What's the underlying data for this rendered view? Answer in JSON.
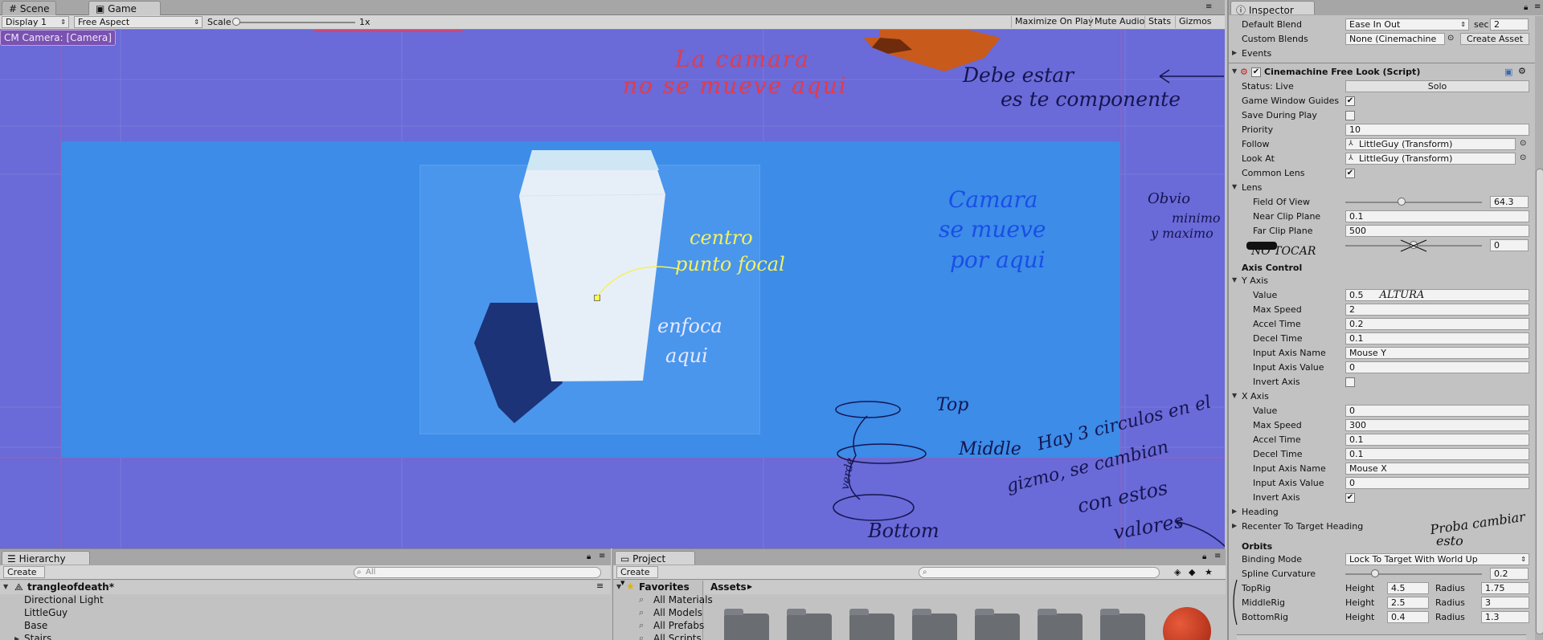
{
  "tabs": {
    "scene": "Scene",
    "game": "Game"
  },
  "game_toolbar": {
    "display": "Display 1",
    "aspect": "Free Aspect",
    "scale_label": "Scale",
    "scale_value": "1x",
    "maximize": "Maximize On Play",
    "mute": "Mute Audio",
    "stats": "Stats",
    "gizmos": "Gizmos"
  },
  "cm_camera_label": "CM Camera: [Camera]",
  "annotations": {
    "no_move_1": "La camara",
    "no_move_2": "no se mueve aqui",
    "must_be_1": "Debe estar",
    "must_be_2": "es te componente",
    "moves_1": "Camara",
    "moves_2": "se mueve",
    "moves_3": "por aqui",
    "center_1": "centro",
    "center_2": "punto focal",
    "focus_1": "enfoca",
    "focus_2": "aqui",
    "top": "Top",
    "middle": "Middle",
    "bottom": "Bottom",
    "side": "verde",
    "circles_1": "Hay 3 circulos en el",
    "circles_2": "gizmo, se cambian",
    "circles_3": "con estos",
    "circles_4": "valores",
    "obvio_1": "Obvio",
    "obvio_2": "minimo",
    "obvio_3": "y maximo",
    "no_tocar": "NO TOCAR",
    "altura": "ALTURA",
    "proba_1": "Proba cambiar",
    "proba_2": "esto"
  },
  "hierarchy": {
    "tab": "Hierarchy",
    "create": "Create",
    "search_placeholder": "All",
    "scene_name": "trangleofdeath*",
    "items": [
      "Directional Light",
      "LittleGuy",
      "Base",
      "Stairs"
    ]
  },
  "project": {
    "tab": "Project",
    "create": "Create",
    "favorites": "Favorites",
    "fav_items": [
      "All Materials",
      "All Models",
      "All Prefabs",
      "All Scripts"
    ],
    "assets": "Assets"
  },
  "inspector": {
    "tab": "Inspector",
    "default_blend_label": "Default Blend",
    "default_blend_value": "Ease In Out",
    "sec_label": "sec",
    "sec_value": "2",
    "custom_blends_label": "Custom Blends",
    "custom_blends_value": "None (Cinemachine",
    "create_asset": "Create Asset",
    "events": "Events",
    "component_title": "Cinemachine Free Look (Script)",
    "status_label": "Status: Live",
    "solo": "Solo",
    "game_window_guides": "Game Window Guides",
    "save_during_play": "Save During Play",
    "priority_label": "Priority",
    "priority_value": "10",
    "follow_label": "Follow",
    "follow_value": "LittleGuy (Transform)",
    "lookat_label": "Look At",
    "lookat_value": "LittleGuy (Transform)",
    "common_lens": "Common Lens",
    "lens": "Lens",
    "fov_label": "Field Of View",
    "fov_value": "64.3",
    "near_label": "Near Clip Plane",
    "near_value": "0.1",
    "far_label": "Far Clip Plane",
    "far_value": "500",
    "dutch_value": "0",
    "axis_control": "Axis Control",
    "y_axis": "Y Axis",
    "y": {
      "value": "0.5",
      "max_speed": "2",
      "accel": "0.2",
      "decel": "0.1",
      "input_name": "Mouse Y",
      "input_value": "0"
    },
    "x_axis": "X Axis",
    "x": {
      "value": "0",
      "max_speed": "300",
      "accel": "0.1",
      "decel": "0.1",
      "input_name": "Mouse X",
      "input_value": "0"
    },
    "labels": {
      "value": "Value",
      "max_speed": "Max Speed",
      "accel": "Accel Time",
      "decel": "Decel Time",
      "input_name": "Input Axis Name",
      "input_value": "Input Axis Value",
      "invert": "Invert Axis"
    },
    "heading": "Heading",
    "recenter": "Recenter To Target Heading",
    "orbits": "Orbits",
    "binding_label": "Binding Mode",
    "binding_value": "Lock To Target With World Up",
    "spline_label": "Spline Curvature",
    "spline_value": "0.2",
    "height_label": "Height",
    "radius_label": "Radius",
    "rigs": [
      {
        "name": "TopRig",
        "height": "4.5",
        "radius": "1.75"
      },
      {
        "name": "MiddleRig",
        "height": "2.5",
        "radius": "3"
      },
      {
        "name": "BottomRig",
        "height": "0.4",
        "radius": "1.3"
      }
    ]
  }
}
